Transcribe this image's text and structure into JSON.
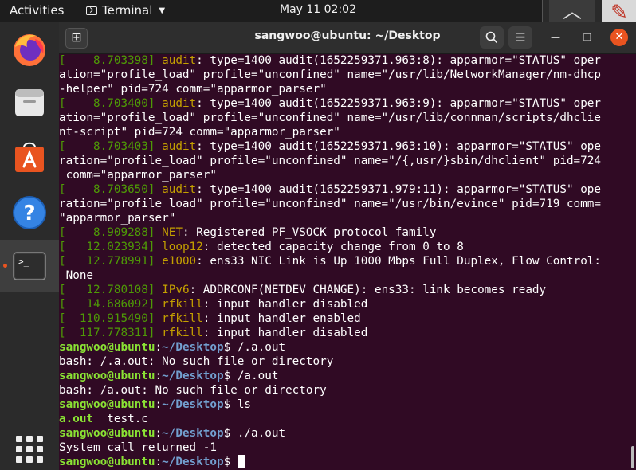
{
  "topbar": {
    "activities": "Activities",
    "app_name": "Terminal",
    "clock": "May 11  02:02"
  },
  "dock": {
    "items": [
      "Firefox",
      "Files",
      "Ubuntu Software",
      "Help",
      "Terminal"
    ],
    "accent": "#e95420"
  },
  "window": {
    "title": "sangwoo@ubuntu: ~/Desktop"
  },
  "terminal": {
    "prompt_user": "sangwoo@ubuntu",
    "prompt_sep": ":",
    "prompt_path": "~/Desktop",
    "prompt_end": "$ ",
    "lines": [
      {
        "kind": "log",
        "ts": "[    8.703398]",
        "src": "audit",
        "rest": ": type=1400 audit(1652259371.963:8): apparmor=\"STATUS\" oper"
      },
      {
        "kind": "plain",
        "text": "ation=\"profile_load\" profile=\"unconfined\" name=\"/usr/lib/NetworkManager/nm-dhcp"
      },
      {
        "kind": "plain",
        "text": "-helper\" pid=724 comm=\"apparmor_parser\""
      },
      {
        "kind": "log",
        "ts": "[    8.703400]",
        "src": "audit",
        "rest": ": type=1400 audit(1652259371.963:9): apparmor=\"STATUS\" oper"
      },
      {
        "kind": "plain",
        "text": "ation=\"profile_load\" profile=\"unconfined\" name=\"/usr/lib/connman/scripts/dhclie"
      },
      {
        "kind": "plain",
        "text": "nt-script\" pid=724 comm=\"apparmor_parser\""
      },
      {
        "kind": "log",
        "ts": "[    8.703403]",
        "src": "audit",
        "rest": ": type=1400 audit(1652259371.963:10): apparmor=\"STATUS\" ope"
      },
      {
        "kind": "plain",
        "text": "ration=\"profile_load\" profile=\"unconfined\" name=\"/{,usr/}sbin/dhclient\" pid=724"
      },
      {
        "kind": "plain",
        "text": " comm=\"apparmor_parser\""
      },
      {
        "kind": "log",
        "ts": "[    8.703650]",
        "src": "audit",
        "rest": ": type=1400 audit(1652259371.979:11): apparmor=\"STATUS\" ope"
      },
      {
        "kind": "plain",
        "text": "ration=\"profile_load\" profile=\"unconfined\" name=\"/usr/bin/evince\" pid=719 comm="
      },
      {
        "kind": "plain",
        "text": "\"apparmor_parser\""
      },
      {
        "kind": "log",
        "ts": "[    8.909288]",
        "src": "NET",
        "rest": ": Registered PF_VSOCK protocol family"
      },
      {
        "kind": "log",
        "ts": "[   12.023934]",
        "src": "loop12",
        "rest": ": detected capacity change from 0 to 8"
      },
      {
        "kind": "log",
        "ts": "[   12.778991]",
        "src": "e1000",
        "rest": ": ens33 NIC Link is Up 1000 Mbps Full Duplex, Flow Control:"
      },
      {
        "kind": "plain",
        "text": " None"
      },
      {
        "kind": "log",
        "ts": "[   12.780108]",
        "src": "IPv6",
        "rest": ": ADDRCONF(NETDEV_CHANGE): ens33: link becomes ready"
      },
      {
        "kind": "log",
        "ts": "[   14.686092]",
        "src": "rfkill",
        "rest": ": input handler disabled"
      },
      {
        "kind": "log",
        "ts": "[  110.915490]",
        "src": "rfkill",
        "rest": ": input handler enabled"
      },
      {
        "kind": "log",
        "ts": "[  117.778311]",
        "src": "rfkill",
        "rest": ": input handler disabled"
      },
      {
        "kind": "prompt",
        "cmd": "/.a.out"
      },
      {
        "kind": "plain",
        "text": "bash: /.a.out: No such file or directory"
      },
      {
        "kind": "prompt",
        "cmd": "/a.out"
      },
      {
        "kind": "plain",
        "text": "bash: /a.out: No such file or directory"
      },
      {
        "kind": "prompt",
        "cmd": "ls"
      },
      {
        "kind": "ls",
        "exe": "a.out",
        "rest": "  test.c"
      },
      {
        "kind": "prompt",
        "cmd": "./a.out"
      },
      {
        "kind": "plain",
        "text": "System call returned -1"
      },
      {
        "kind": "prompt",
        "cmd": "",
        "cursor": true
      }
    ]
  }
}
